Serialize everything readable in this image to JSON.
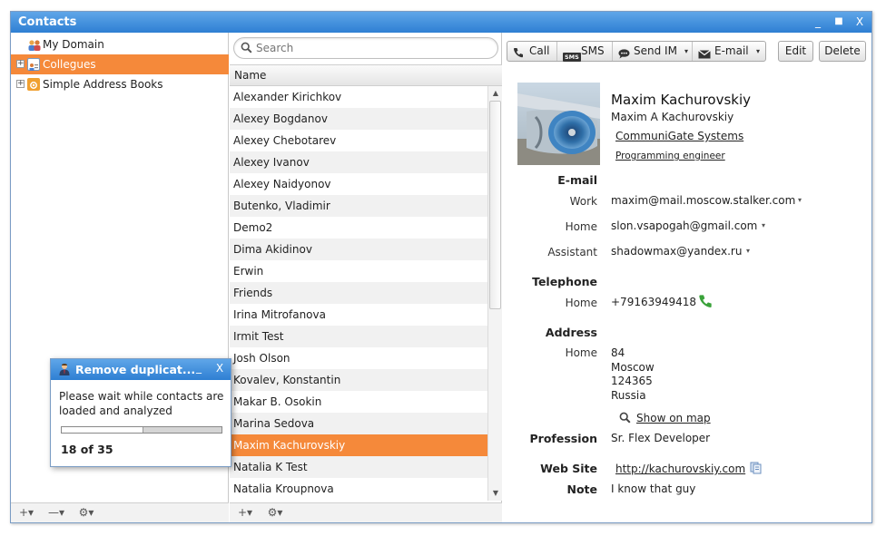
{
  "window": {
    "title": "Contacts",
    "minimize_glyph": "_",
    "maximize_glyph": "■",
    "close_glyph": "X"
  },
  "sidebar": {
    "items": [
      {
        "label": "My Domain",
        "icon": "users-icon",
        "expandable": false,
        "selected": false
      },
      {
        "label": "Collegues",
        "icon": "address-card-icon",
        "expandable": true,
        "selected": true
      },
      {
        "label": "Simple Address Books",
        "icon": "address-book-icon",
        "expandable": true,
        "selected": false
      }
    ],
    "bottom_buttons": [
      {
        "label": "+▾",
        "icon": "add-icon"
      },
      {
        "label": "—▾",
        "icon": "remove-icon"
      },
      {
        "label": "⚙▾",
        "icon": "gear-icon"
      }
    ]
  },
  "contacts_list": {
    "search_placeholder": "Search",
    "column_header": "Name",
    "rows": [
      "Alexander Kirichkov",
      "Alexey Bogdanov",
      "Alexey Chebotarev",
      "Alexey Ivanov",
      "Alexey Naidyonov",
      "Butenko, Vladimir",
      "Demo2",
      "Dima Akidinov",
      "Erwin",
      "Friends",
      "Irina Mitrofanova",
      "Irmit Test",
      "Josh Olson",
      "Kovalev, Konstantin",
      "Makar B. Osokin",
      "Marina Sedova",
      "Maxim Kachurovskiy",
      "Natalia K Test",
      "Natalia Kroupnova"
    ],
    "selected_row": "Maxim Kachurovskiy",
    "bottom_buttons": [
      {
        "label": "+▾",
        "icon": "add-icon"
      },
      {
        "label": "⚙▾",
        "icon": "gear-icon"
      }
    ]
  },
  "toolbar": {
    "call_label": "Call",
    "sms_label": "SMS",
    "sms_badge": "SMS",
    "sendim_label": "Send IM",
    "email_label": "E-mail",
    "edit_label": "Edit",
    "delete_label": "Delete"
  },
  "contact": {
    "display_name": "Maxim Kachurovskiy",
    "full_name": "Maxim A Kachurovskiy",
    "company": "CommuniGate Systems",
    "job_title": "Programming engineer",
    "email_section": "E-mail",
    "emails": [
      {
        "label": "Work",
        "value": "maxim@mail.moscow.stalker.com"
      },
      {
        "label": "Home",
        "value": "slon.vsapogah@gmail.com"
      },
      {
        "label": "Assistant",
        "value": "shadowmax@yandex.ru"
      }
    ],
    "telephone_section": "Telephone",
    "phone": {
      "label": "Home",
      "value": "+79163949418"
    },
    "address_section": "Address",
    "address": {
      "label": "Home",
      "lines": [
        "84",
        "Moscow",
        "124365",
        "Russia"
      ]
    },
    "show_on_map": "Show on map",
    "profession_label": "Profession",
    "profession": "Sr. Flex Developer",
    "website_label": "Web Site",
    "website": "http://kachurovskiy.com",
    "note_label": "Note",
    "note": "I know that guy"
  },
  "dialog": {
    "title": "Remove duplicat...",
    "message": "Please wait while contacts are loaded and analyzed",
    "progress_fraction": 0.514,
    "count_text": "18 of 35",
    "minimize_glyph": "_",
    "close_glyph": "X"
  },
  "colors": {
    "titlebar": "#2e7fd3",
    "selection": "#f5893a",
    "phone_icon": "#3aa23a"
  }
}
